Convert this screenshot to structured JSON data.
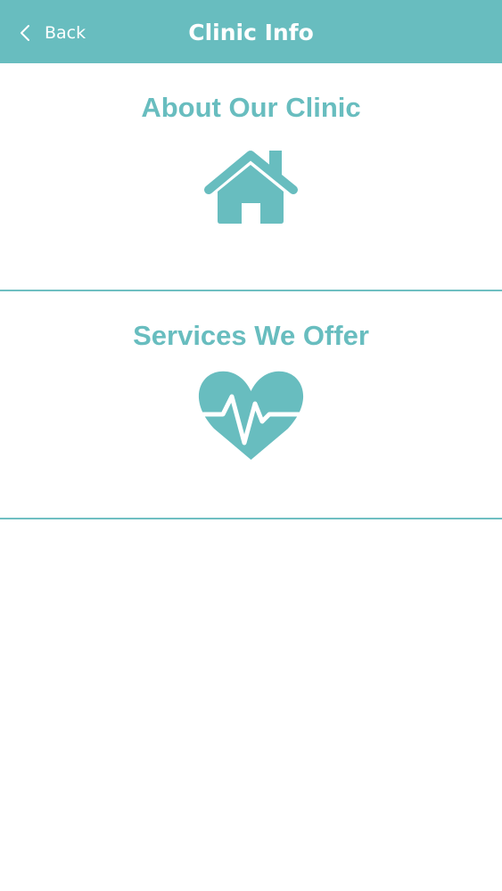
{
  "colors": {
    "accent": "#68bdbf",
    "background": "#ffffff",
    "nav_text": "#ffffff"
  },
  "navbar": {
    "back_label": "Back",
    "back_icon": "chevron-left-icon",
    "title": "Clinic Info"
  },
  "menu": {
    "items": [
      {
        "label": "About Our Clinic",
        "icon": "house-icon"
      },
      {
        "label": "Services We Offer",
        "icon": "heart-pulse-icon"
      }
    ]
  }
}
